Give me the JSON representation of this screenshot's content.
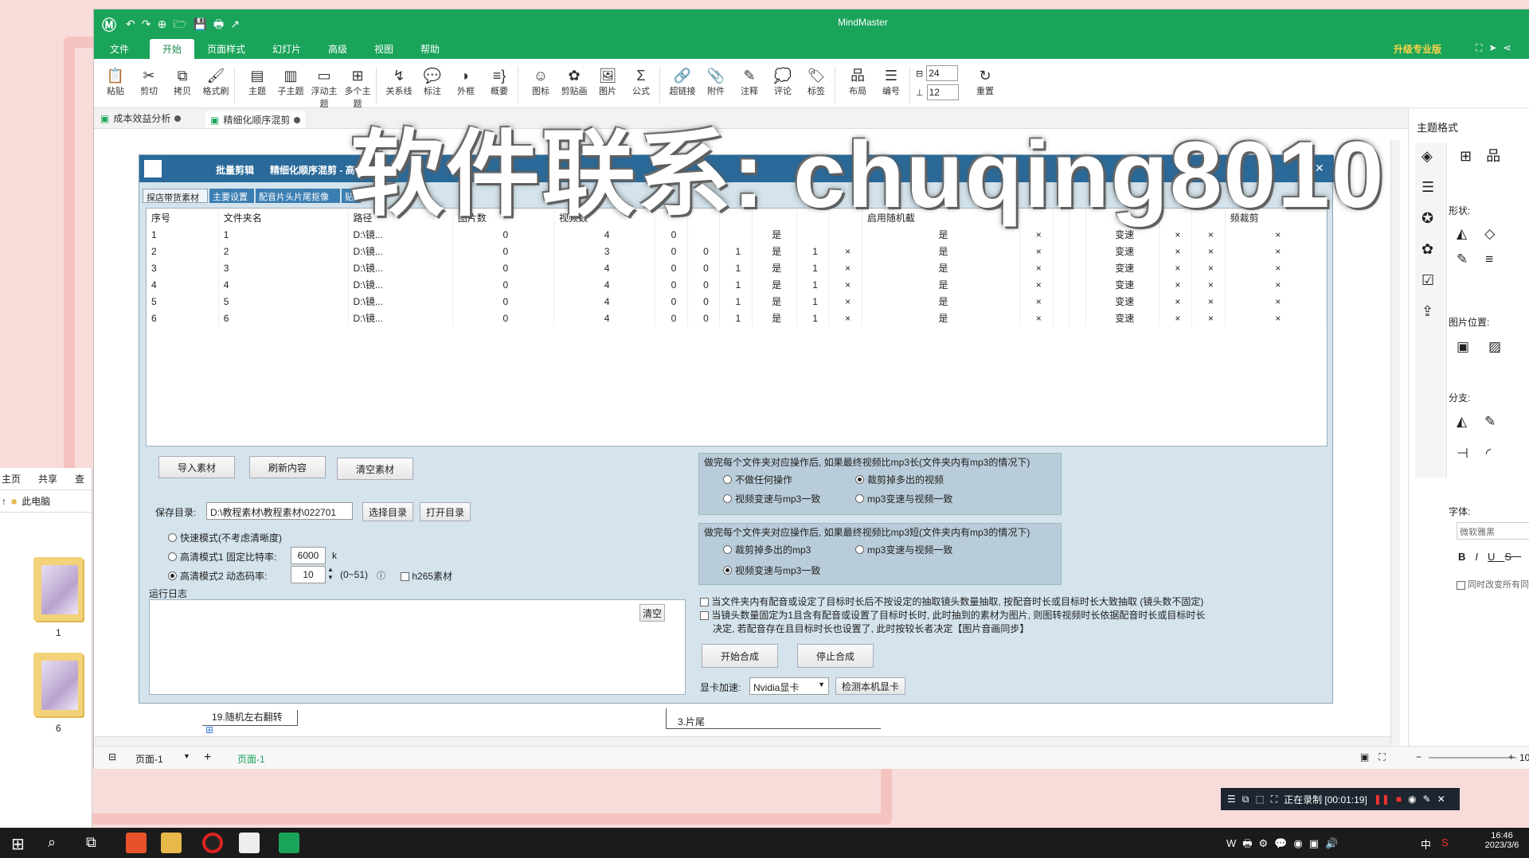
{
  "app": {
    "title": "MindMaster",
    "upgrade": "升级专业版"
  },
  "menu": [
    "文件",
    "开始",
    "页面样式",
    "幻灯片",
    "高级",
    "视图",
    "帮助"
  ],
  "menu_active": 1,
  "ribbon": [
    {
      "label": "粘贴",
      "icon": "paste-icon",
      "glyph": "📋"
    },
    {
      "label": "剪切",
      "icon": "cut-icon",
      "glyph": "✂"
    },
    {
      "label": "拷贝",
      "icon": "copy-icon",
      "glyph": "⧉"
    },
    {
      "label": "格式刷",
      "icon": "format-brush-icon",
      "glyph": "🖌"
    },
    {
      "label": "主题",
      "icon": "topic-icon",
      "glyph": "▤"
    },
    {
      "label": "子主题",
      "icon": "subtopic-icon",
      "glyph": "▥"
    },
    {
      "label": "浮动主题",
      "icon": "floating-topic-icon",
      "glyph": "▭"
    },
    {
      "label": "多个主题",
      "icon": "multi-topic-icon",
      "glyph": "⊞"
    },
    {
      "label": "关系线",
      "icon": "relationship-icon",
      "glyph": "↯"
    },
    {
      "label": "标注",
      "icon": "callout-icon",
      "glyph": "💬"
    },
    {
      "label": "外框",
      "icon": "boundary-icon",
      "glyph": "◗"
    },
    {
      "label": "概要",
      "icon": "summary-icon",
      "glyph": "≡}"
    },
    {
      "label": "图标",
      "icon": "icon-icon",
      "glyph": "☺"
    },
    {
      "label": "剪贴画",
      "icon": "clipart-icon",
      "glyph": "✿"
    },
    {
      "label": "图片",
      "icon": "image-icon",
      "glyph": "🖼"
    },
    {
      "label": "公式",
      "icon": "formula-icon",
      "glyph": "Σ"
    },
    {
      "label": "超链接",
      "icon": "hyperlink-icon",
      "glyph": "🔗"
    },
    {
      "label": "附件",
      "icon": "attachment-icon",
      "glyph": "📎"
    },
    {
      "label": "注释",
      "icon": "note-icon",
      "glyph": "✎"
    },
    {
      "label": "评论",
      "icon": "comment-icon",
      "glyph": "💭"
    },
    {
      "label": "标签",
      "icon": "tag-icon",
      "glyph": "🏷"
    },
    {
      "label": "布局",
      "icon": "layout-icon",
      "glyph": "品"
    },
    {
      "label": "编号",
      "icon": "numbering-icon",
      "glyph": "☰"
    },
    {
      "label": "重置",
      "icon": "reset-icon",
      "glyph": "↻"
    }
  ],
  "spacing": {
    "h": "24",
    "v": "12"
  },
  "doc_tabs": [
    "成本效益分析",
    "精细化顺序混剪"
  ],
  "right_panel": {
    "title": "主题格式",
    "shape": "形状:",
    "image_pos": "图片位置:",
    "branch": "分支:",
    "font": "字体:",
    "font_value": "微软雅黑",
    "sync": "同时改变所有同"
  },
  "status": {
    "page_select": "页面-1",
    "page_tab": "页面-1",
    "zoom": "10"
  },
  "canvas_nodes": [
    "19.随机左右翻转",
    "3.片尾"
  ],
  "dialog": {
    "title_a": "批量剪辑",
    "title_b": "精细化顺序混剪 - 高",
    "tabs": [
      "探店带货素材",
      "主要设置",
      "配音片头片尾抠像",
      "贴纸"
    ],
    "columns": [
      "序号",
      "文件夹名",
      "路径",
      "图片数",
      "视频数",
      "",
      "",
      "",
      "",
      "",
      "",
      "启用随机截",
      "",
      "",
      "",
      "",
      "",
      "",
      "频裁剪"
    ],
    "rows": [
      [
        "1",
        "1",
        "D:\\镜...",
        "0",
        "4",
        "0",
        "",
        "",
        "是",
        "",
        "",
        "是",
        "×",
        "",
        "",
        "变速",
        "×",
        "×",
        "×"
      ],
      [
        "2",
        "2",
        "D:\\镜...",
        "0",
        "3",
        "0",
        "0",
        "1",
        "是",
        "1",
        "×",
        "是",
        "×",
        "",
        "",
        "变速",
        "×",
        "×",
        "×"
      ],
      [
        "3",
        "3",
        "D:\\镜...",
        "0",
        "4",
        "0",
        "0",
        "1",
        "是",
        "1",
        "×",
        "是",
        "×",
        "",
        "",
        "变速",
        "×",
        "×",
        "×"
      ],
      [
        "4",
        "4",
        "D:\\镜...",
        "0",
        "4",
        "0",
        "0",
        "1",
        "是",
        "1",
        "×",
        "是",
        "×",
        "",
        "",
        "变速",
        "×",
        "×",
        "×"
      ],
      [
        "5",
        "5",
        "D:\\镜...",
        "0",
        "4",
        "0",
        "0",
        "1",
        "是",
        "1",
        "×",
        "是",
        "×",
        "",
        "",
        "变速",
        "×",
        "×",
        "×"
      ],
      [
        "6",
        "6",
        "D:\\镜...",
        "0",
        "4",
        "0",
        "0",
        "1",
        "是",
        "1",
        "×",
        "是",
        "×",
        "",
        "",
        "变速",
        "×",
        "×",
        "×"
      ]
    ],
    "btn_import": "导入素材",
    "btn_refresh": "刷新内容",
    "btn_clear_material": "清空素材",
    "save_dir_label": "保存目录:",
    "save_dir_value": "D:\\教程素材\\教程素材\\022701",
    "btn_choose_dir": "选择目录",
    "btn_open_dir": "打开目录",
    "mode_fast": "快速模式(不考虑清晰度)",
    "mode_hd1": "高清模式1 固定比特率:",
    "hd1_value": "6000",
    "hd1_unit": "k",
    "mode_hd2": "高清模式2 动态码率:",
    "hd2_value": "10",
    "hd2_range": "(0~51)",
    "h265": "h265素材",
    "log_label": "运行日志",
    "btn_clear_log": "清空",
    "group1_title": "做完每个文件夹对应操作后, 如果最终视频比mp3长(文件夹内有mp3的情况下)",
    "g1_opt1": "不做任何操作",
    "g1_opt2": "裁剪掉多出的视频",
    "g1_opt3": "视频变速与mp3一致",
    "g1_opt4": "mp3变速与视频一致",
    "group2_title": "做完每个文件夹对应操作后, 如果最终视频比mp3短(文件夹内有mp3的情况下)",
    "g2_opt1": "裁剪掉多出的mp3",
    "g2_opt2": "mp3变速与视频一致",
    "g2_opt3": "视频变速与mp3一致",
    "check1": "当文件夹内有配音或设定了目标时长后不按设定的抽取镜头数量抽取, 按配音时长或目标时长大致抽取 (镜头数不固定)",
    "check2_a": "当镜头数量固定为1且含有配音或设置了目标时长时, 此时抽到的素材为图片, 则图转视频时长依据配音时长或目标时长",
    "check2_b": "决定, 若配音存在且目标时长也设置了, 此时按较长者决定【图片音画同步】",
    "btn_start": "开始合成",
    "btn_stop": "停止合成",
    "gpu_label": "显卡加速:",
    "gpu_value": "Nvidia显卡",
    "btn_detect_gpu": "检测本机显卡"
  },
  "watermark": "软件联系: chuqing8010",
  "explorer": {
    "tabs": [
      "主页",
      "共享",
      "查"
    ],
    "path": "此电脑",
    "folders": [
      "1",
      "6"
    ]
  },
  "recording": {
    "label": "正在录制 [00:01:19]"
  },
  "clock": {
    "time": "16:46",
    "date": "2023/3/6"
  },
  "tray_ime": "中"
}
